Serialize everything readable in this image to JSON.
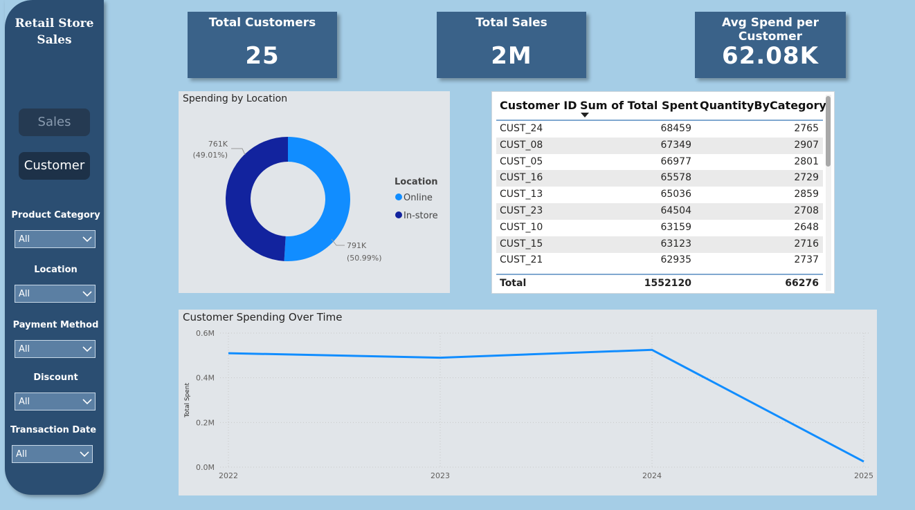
{
  "sidebar": {
    "title_line1": "Retail Store",
    "title_line2": "Sales",
    "nav": {
      "sales": "Sales",
      "customer": "Customer"
    },
    "filters": [
      {
        "label": "Product Category",
        "value": "All"
      },
      {
        "label": "Location",
        "value": "All"
      },
      {
        "label": "Payment Method",
        "value": "All"
      },
      {
        "label": "Discount",
        "value": "All"
      },
      {
        "label": "Transaction Date",
        "value": "All"
      }
    ]
  },
  "kpis": {
    "customers": {
      "title": "Total Customers",
      "value": "25"
    },
    "sales": {
      "title": "Total Sales",
      "value": "2M"
    },
    "avg": {
      "title": "Avg Spend per Customer",
      "value": "62.08K"
    }
  },
  "colors": {
    "online": "#118dff",
    "instore": "#12239e",
    "line": "#118dff",
    "kpi_bg": "#3a6289",
    "sidebar_bg": "#2b4e72"
  },
  "table": {
    "headers": {
      "id": "Customer ID",
      "spent": "Sum of Total Spent",
      "qty": "QuantityByCategory"
    },
    "rows": [
      {
        "id": "CUST_24",
        "spent": "68459",
        "qty": "2765"
      },
      {
        "id": "CUST_08",
        "spent": "67349",
        "qty": "2907"
      },
      {
        "id": "CUST_05",
        "spent": "66977",
        "qty": "2801"
      },
      {
        "id": "CUST_16",
        "spent": "65578",
        "qty": "2729"
      },
      {
        "id": "CUST_13",
        "spent": "65036",
        "qty": "2859"
      },
      {
        "id": "CUST_23",
        "spent": "64504",
        "qty": "2708"
      },
      {
        "id": "CUST_10",
        "spent": "63159",
        "qty": "2648"
      },
      {
        "id": "CUST_15",
        "spent": "63123",
        "qty": "2716"
      },
      {
        "id": "CUST_21",
        "spent": "62935",
        "qty": "2737"
      }
    ],
    "total": {
      "label": "Total",
      "spent": "1552120",
      "qty": "66276"
    }
  },
  "chart_data": [
    {
      "type": "pie",
      "title": "Spending by Location",
      "legend_title": "Location",
      "legend_position": "right",
      "donut": true,
      "slices": [
        {
          "name": "Online",
          "value": 791,
          "label": "791K",
          "pct_label": "(50.99%)",
          "color": "#118dff"
        },
        {
          "name": "In-store",
          "value": 761,
          "label": "761K",
          "pct_label": "(49.01%)",
          "color": "#12239e"
        }
      ]
    },
    {
      "type": "line",
      "title": "Customer Spending Over Time",
      "xlabel": "",
      "ylabel": "Total Spent",
      "x": [
        "2022",
        "2023",
        "2024",
        "2025"
      ],
      "series": [
        {
          "values": [
            0.51,
            0.49,
            0.525,
            0.025
          ]
        }
      ],
      "ylim": [
        0,
        0.6
      ],
      "yticks": [
        {
          "v": 0,
          "label": "0.0M"
        },
        {
          "v": 0.2,
          "label": "0.2M"
        },
        {
          "v": 0.4,
          "label": "0.4M"
        },
        {
          "v": 0.6,
          "label": "0.6M"
        }
      ],
      "grid": true
    }
  ]
}
